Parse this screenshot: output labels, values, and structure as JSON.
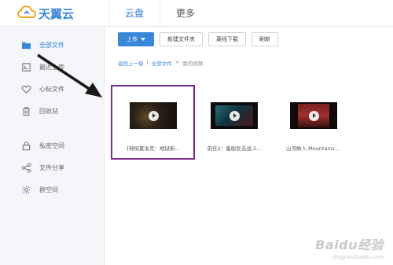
{
  "app": {
    "logo_text": "天翼云",
    "brand_color": "#3a86d8"
  },
  "topnav": {
    "items": [
      {
        "label": "云盘",
        "active": true
      },
      {
        "label": "更多",
        "active": false
      }
    ]
  },
  "sidebar": {
    "items": [
      {
        "label": "全部文件",
        "icon": "folder-icon",
        "active": true
      },
      {
        "label": "最近上传",
        "icon": "recent-icon",
        "active": false
      },
      {
        "label": "心标文件",
        "icon": "heart-icon",
        "active": false
      },
      {
        "label": "回收站",
        "icon": "trash-icon",
        "active": false
      },
      {
        "label": "私密空间",
        "icon": "lock-icon",
        "active": false
      },
      {
        "label": "文件分享",
        "icon": "share-icon",
        "active": false
      },
      {
        "label": "群空间",
        "icon": "group-icon",
        "active": false
      }
    ]
  },
  "toolbar": {
    "upload_label": "上传",
    "new_folder_label": "新建文件夹",
    "offline_download_label": "离线下载",
    "refresh_label": "刷新"
  },
  "breadcrumb": {
    "back_label": "返回上一级",
    "separator": "|",
    "root_label": "全部文件",
    "arrow": ">",
    "current_label": "我的视频"
  },
  "files": [
    {
      "name": "[神探夏洛克：地狱新...",
      "type": "video",
      "selected": true
    },
    {
      "name": "前任2：备胎反击战.2...",
      "type": "video",
      "selected": false
    },
    {
      "name": "山河故人.Mountains....",
      "type": "video",
      "selected": false
    }
  ],
  "annotation": {
    "arrow_color": "#1a1a1a",
    "highlight_color": "#7a2c8c"
  },
  "watermark": {
    "brand": "Baidu经验",
    "sub": "jingyan.baidu.com"
  }
}
